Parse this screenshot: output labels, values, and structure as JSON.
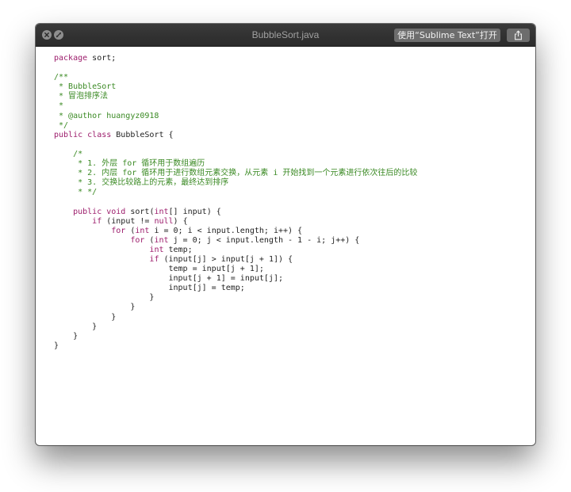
{
  "window": {
    "title": "BubbleSort.java",
    "open_with_label": "使用“Sublime Text”打开",
    "icons": {
      "close": "close-icon",
      "fullscreen": "fullscreen-icon",
      "share": "share-icon"
    }
  },
  "colors": {
    "keyword": "#9c1c6b",
    "comment": "#3b8a24",
    "text": "#1f1f1f",
    "titlebar": "#2f2f2f"
  },
  "code": {
    "lines": [
      [
        {
          "k": "kw",
          "t": "package"
        },
        {
          "k": "pl",
          "t": " sort;"
        }
      ],
      [],
      [
        {
          "k": "cm",
          "t": "/**"
        }
      ],
      [
        {
          "k": "cm",
          "t": " * BubbleSort"
        }
      ],
      [
        {
          "k": "cm",
          "t": " * 冒泡排序法"
        }
      ],
      [
        {
          "k": "cm",
          "t": " *"
        }
      ],
      [
        {
          "k": "cm",
          "t": " * @author huangyz0918"
        }
      ],
      [
        {
          "k": "cm",
          "t": " */"
        }
      ],
      [
        {
          "k": "kw",
          "t": "public"
        },
        {
          "k": "pl",
          "t": " "
        },
        {
          "k": "kw",
          "t": "class"
        },
        {
          "k": "pl",
          "t": " BubbleSort {"
        }
      ],
      [],
      [
        {
          "k": "cm",
          "t": "    /*"
        }
      ],
      [
        {
          "k": "cm",
          "t": "     * 1. 外层 for 循环用于数组遍历"
        }
      ],
      [
        {
          "k": "cm",
          "t": "     * 2. 内层 for 循环用于进行数组元素交换，从元素 i 开始找到一个元素进行依次往后的比较"
        }
      ],
      [
        {
          "k": "cm",
          "t": "     * 3. 交换比较路上的元素，最终达到排序"
        }
      ],
      [
        {
          "k": "cm",
          "t": "     * */"
        }
      ],
      [],
      [
        {
          "k": "pl",
          "t": "    "
        },
        {
          "k": "kw",
          "t": "public"
        },
        {
          "k": "pl",
          "t": " "
        },
        {
          "k": "kw",
          "t": "void"
        },
        {
          "k": "pl",
          "t": " sort("
        },
        {
          "k": "kw",
          "t": "int"
        },
        {
          "k": "pl",
          "t": "[] input) {"
        }
      ],
      [
        {
          "k": "pl",
          "t": "        "
        },
        {
          "k": "kw",
          "t": "if"
        },
        {
          "k": "pl",
          "t": " (input != "
        },
        {
          "k": "kw",
          "t": "null"
        },
        {
          "k": "pl",
          "t": ") {"
        }
      ],
      [
        {
          "k": "pl",
          "t": "            "
        },
        {
          "k": "kw",
          "t": "for"
        },
        {
          "k": "pl",
          "t": " ("
        },
        {
          "k": "kw",
          "t": "int"
        },
        {
          "k": "pl",
          "t": " i = 0; i < input.length; i++) {"
        }
      ],
      [
        {
          "k": "pl",
          "t": "                "
        },
        {
          "k": "kw",
          "t": "for"
        },
        {
          "k": "pl",
          "t": " ("
        },
        {
          "k": "kw",
          "t": "int"
        },
        {
          "k": "pl",
          "t": " j = 0; j < input.length - 1 - i; j++) {"
        }
      ],
      [
        {
          "k": "pl",
          "t": "                    "
        },
        {
          "k": "kw",
          "t": "int"
        },
        {
          "k": "pl",
          "t": " temp;"
        }
      ],
      [
        {
          "k": "pl",
          "t": "                    "
        },
        {
          "k": "kw",
          "t": "if"
        },
        {
          "k": "pl",
          "t": " (input[j] > input[j + 1]) {"
        }
      ],
      [
        {
          "k": "pl",
          "t": "                        temp = input[j + 1];"
        }
      ],
      [
        {
          "k": "pl",
          "t": "                        input[j + 1] = input[j];"
        }
      ],
      [
        {
          "k": "pl",
          "t": "                        input[j] = temp;"
        }
      ],
      [
        {
          "k": "pl",
          "t": "                    }"
        }
      ],
      [
        {
          "k": "pl",
          "t": "                }"
        }
      ],
      [
        {
          "k": "pl",
          "t": "            }"
        }
      ],
      [
        {
          "k": "pl",
          "t": "        }"
        }
      ],
      [
        {
          "k": "pl",
          "t": "    }"
        }
      ],
      [
        {
          "k": "pl",
          "t": "}"
        }
      ]
    ]
  }
}
